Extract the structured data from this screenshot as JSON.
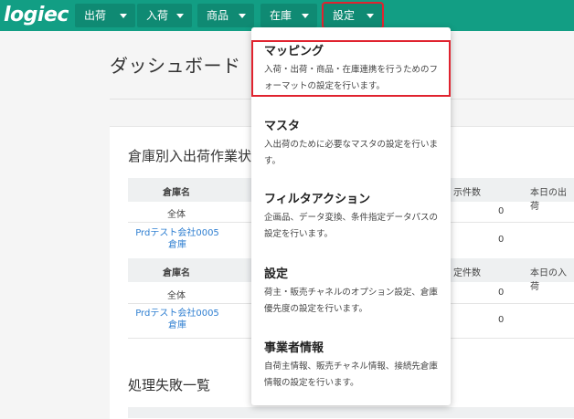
{
  "app": {
    "logo": "logiec"
  },
  "nav": [
    {
      "label": "出荷"
    },
    {
      "label": "入荷"
    },
    {
      "label": "商品"
    },
    {
      "label": "在庫"
    },
    {
      "label": "設定"
    }
  ],
  "page": {
    "title": "ダッシュボード"
  },
  "warehouse_section": {
    "title": "倉庫別入出荷作業状",
    "table1": {
      "headers": [
        "倉庫名",
        "示件数",
        "本日の出荷"
      ],
      "rows": [
        {
          "name": "全体",
          "count": "0"
        },
        {
          "name": "Prdテスト会社0005\n倉庫",
          "count": "0"
        }
      ]
    },
    "table2": {
      "headers": [
        "倉庫名",
        "定件数",
        "本日の入荷"
      ],
      "rows": [
        {
          "name": "全体",
          "count": "0"
        },
        {
          "name": "Prdテスト会社0005\n倉庫",
          "count": "0"
        }
      ]
    }
  },
  "failure_section": {
    "title": "処理失敗一覧"
  },
  "settings_menu": [
    {
      "title": "マッピング",
      "desc": "入荷・出荷・商品・在庫連携を行うためのフォーマットの設定を行います。"
    },
    {
      "title": "マスタ",
      "desc": "入出荷のために必要なマスタの設定を行います。"
    },
    {
      "title": "フィルタアクション",
      "desc": "企画品、データ変換、条件指定データパスの設定を行います。"
    },
    {
      "title": "設定",
      "desc": "荷主・販売チャネルのオプション設定、倉庫優先度の設定を行います。"
    },
    {
      "title": "事業者情報",
      "desc": "自荷主情報、販売チャネル情報、接続先倉庫情報の設定を行います。"
    }
  ]
}
